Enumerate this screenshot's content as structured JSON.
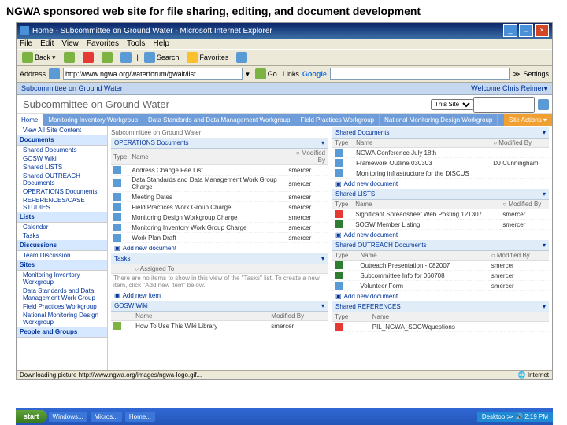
{
  "slide_title": "NGWA sponsored web site for file sharing, editing, and document development",
  "window": {
    "title": "Home - Subcommittee on Ground Water - Microsoft Internet Explorer"
  },
  "menu": [
    "File",
    "Edit",
    "View",
    "Favorites",
    "Tools",
    "Help"
  ],
  "toolbar": {
    "back": "Back",
    "search": "Search",
    "favorites": "Favorites"
  },
  "addr": {
    "label": "Address",
    "url": "http://www.ngwa.org/waterforum/gwalt/list",
    "go": "Go",
    "links": "Links",
    "google": "Google",
    "settings": "Settings"
  },
  "sp": {
    "breadcrumb": "Subcommittee on Ground Water",
    "welcome": "Welcome Chris Reimer",
    "title": "Subcommittee on Ground Water",
    "scope": "This Site",
    "siteactions": "Site Actions"
  },
  "tabs": [
    "Home",
    "Monitoring Inventory Workgroup",
    "Data Standards and Data Management Workgroup",
    "Field Practices Workgroup",
    "National Monitoring Design Workgroup"
  ],
  "nav": {
    "view_all": "View All Site Content",
    "documents": "Documents",
    "doc_items": [
      "Shared Documents",
      "GOSW Wiki",
      "Shared LISTS",
      "Shared OUTREACH Documents",
      "OPERATIONS Documents",
      "REFERENCES/CASE STUDIES"
    ],
    "lists": "Lists",
    "list_items": [
      "Calendar",
      "Tasks"
    ],
    "discussions": "Discussions",
    "disc_items": [
      "Team Discussion"
    ],
    "sites": "Sites",
    "site_items": [
      "Monitoring Inventory Workgroup",
      "Data Standards and Data Management Work Group",
      "Field Practices Workgroup",
      "National Monitoring Design Workgroup"
    ],
    "people": "People and Groups"
  },
  "main": {
    "bc": "Subcommittee on Ground Water",
    "ops": {
      "title": "OPERATIONS Documents",
      "cols": [
        "Type",
        "Name",
        "Modified By"
      ],
      "rows": [
        [
          "",
          "Address Change Fee List",
          "smercer"
        ],
        [
          "",
          "Data Standards and Data Management Work Group Charge",
          "smercer"
        ],
        [
          "",
          "Meeting Dates",
          "smercer"
        ],
        [
          "",
          "Field Practices Work Group Charge",
          "smercer"
        ],
        [
          "",
          "Monitoring Design Workgroup Charge",
          "smercer"
        ],
        [
          "",
          "Monitoring Inventory Work Group Charge",
          "smercer"
        ],
        [
          "",
          "Work Plan Draft",
          "smercer"
        ]
      ],
      "add": "Add new document"
    },
    "tasks": {
      "title": "Tasks",
      "cols": [
        "",
        "Assigned To"
      ],
      "empty": "There are no items to show in this view of the \"Tasks\" list. To create a new item, click \"Add new item\" below.",
      "add": "Add new item"
    },
    "wiki": {
      "title": "GOSW Wiki",
      "cols": [
        "",
        "Name",
        "Modified By"
      ],
      "rows": [
        [
          "",
          "How To Use This Wiki Library",
          "smercer"
        ]
      ]
    },
    "shared_docs": {
      "title": "Shared Documents",
      "cols": [
        "Type",
        "Name",
        "Modified By"
      ],
      "rows": [
        [
          "",
          "NGWA Conference July 18th",
          ""
        ],
        [
          "",
          "Framework Outline 030303",
          "DJ Cunningham"
        ],
        [
          "",
          "Monitoring infrastructure for the DISCUS",
          ""
        ]
      ],
      "add": "Add new document"
    },
    "shared_lists": {
      "title": "Shared LISTS",
      "cols": [
        "Type",
        "Name",
        "Modified By"
      ],
      "rows": [
        [
          "r",
          "Significant Spreadsheet Web Posting 121307",
          "smercer"
        ],
        [
          "x",
          "SOGW Member Listing",
          "smercer"
        ]
      ],
      "add": "Add new document"
    },
    "outreach": {
      "title": "Shared OUTREACH Documents",
      "cols": [
        "Type",
        "Name",
        "Modified By"
      ],
      "rows": [
        [
          "x",
          "Outreach Presentation - 082007",
          "smercer"
        ],
        [
          "x",
          "Subcommittee Info for 060708",
          "smercer"
        ],
        [
          "b",
          "Volunteer Form",
          "smercer"
        ]
      ],
      "add": "Add new document"
    },
    "refs": {
      "title": "Shared REFERENCES",
      "cols": [
        "Type",
        "Name"
      ],
      "rows": [
        [
          "r",
          "PIL_NGWA_SOGWquestions"
        ]
      ]
    }
  },
  "taskbar": {
    "start": "start",
    "dlpath": "Downloading picture http://www.ngwa.org/images/ngwa-logo.gif...",
    "items": [
      "Windows...",
      "Micros...",
      "Home..."
    ],
    "desktop": "Desktop",
    "internet": "Internet",
    "time": "2:19 PM"
  }
}
